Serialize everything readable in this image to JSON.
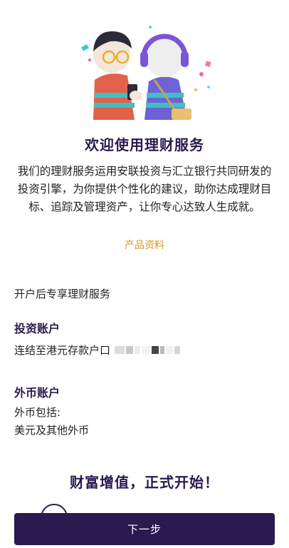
{
  "header": {
    "title": "欢迎使用理财服务"
  },
  "intro": {
    "text": "我们的理财服务运用安联投资与汇立银行共同研发的投资引擎，为你提供个性化的建议，助你达成理财目标、追踪及管理资产，让你专心达致人生成就。"
  },
  "links": {
    "product_info": "产品资料"
  },
  "section": {
    "subtitle": "开户后专享理财服务"
  },
  "investment_account": {
    "heading": "投资账户",
    "linked_to": "连结至港元存款户口"
  },
  "fx_account": {
    "heading": "外币账户",
    "includes_label": "外币包括:",
    "currencies": "美元及其他外币"
  },
  "slogan": "财富增值，正式开始！",
  "footer": {
    "next_button": "下一步"
  },
  "colors": {
    "brand": "#2a1a4f",
    "accent": "#d4982e"
  }
}
